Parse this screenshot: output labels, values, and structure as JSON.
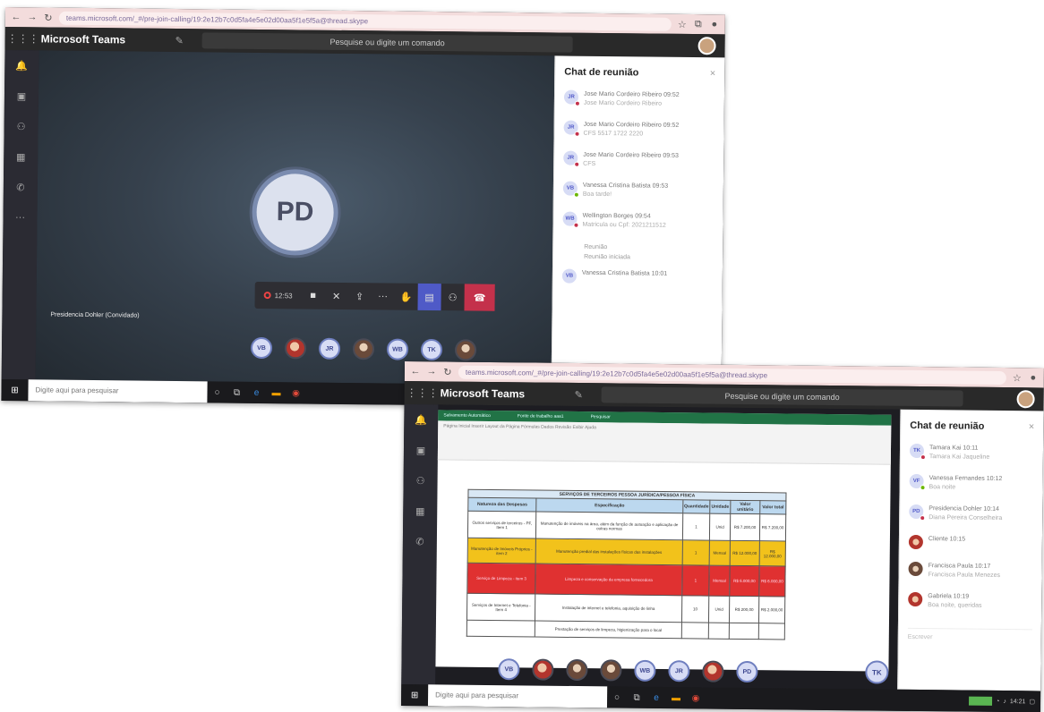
{
  "shot1": {
    "browser": {
      "url": "teams.microsoft.com/_#/pre-join-calling/19:2e12b7c0d5fa4e5e02d00aa5f1e5f5a@thread.skype"
    },
    "app_title": "Microsoft Teams",
    "search_placeholder": "Pesquise ou digite um comando",
    "presenter_initials": "PD",
    "presenter_name": "Presidencia Dohler (Convidado)",
    "call": {
      "timer": "12:53"
    },
    "participants": [
      "VB",
      "",
      "JR",
      "",
      "WB",
      "TK",
      ""
    ],
    "chat": {
      "title": "Chat de reunião",
      "messages": [
        {
          "initials": "JR",
          "line1": "Jose Mario Cordeiro Ribeiro 09:52",
          "line2": "Jose Mario Cordeiro Ribeiro"
        },
        {
          "initials": "JR",
          "line1": "Jose Mario Cordeiro Ribeiro 09:52",
          "line2": "CFS 5517 1722 2220"
        },
        {
          "initials": "JR",
          "line1": "Jose Mario Cordeiro Ribeiro 09:53",
          "line2": "CFS"
        },
        {
          "initials": "VB",
          "line1": "Vanessa Cristina Batista 09:53",
          "line2": "Boa tarde!"
        },
        {
          "initials": "WB",
          "line1": "Wellington Borges 09:54",
          "line2": "Matricula ou Cpf: 2021211512"
        }
      ],
      "notice": "Reunião",
      "notice_sub": "Reunião iniciada",
      "last_initials": "VB",
      "last_line": "Vanessa Cristina Batista 10:01"
    },
    "taskbar": {
      "search": "Digite aqui para pesquisar"
    }
  },
  "shot2": {
    "browser": {
      "url": "teams.microsoft.com/_#/pre-join-calling/19:2e12b7c0d5fa4e5e02d00aa5f1e5f5a@thread.skype"
    },
    "app_title": "Microsoft Teams",
    "search_placeholder": "Pesquise ou digite um comando",
    "excel": {
      "bar": [
        "Salvamento Automático",
        "Fonte de trabalho aaa1",
        "Pesquisar"
      ],
      "ribbon": "Página Inicial   Inserir   Layout da Página   Fórmulas   Dados   Revisão   Exibir   Ajuda",
      "caption": "SERVIÇOS DE TERCEIROS PESSOA JURÍDICA/PESSOA FÍSICA",
      "headers": [
        "Natureza das Despesas",
        "Especificação",
        "Quantidade",
        "Unidade",
        "Valor unitário",
        "Valor total"
      ],
      "rows": [
        [
          "Outros serviços de terceiros - PF, Item 1",
          "Manutenção de imóveis na área, além da função de autuação e aplicação de outras normas",
          "1",
          "Unid",
          "R$ 7.200,00",
          "R$ 7.200,00"
        ],
        [
          "Manutenção de Imóveis Próprios - item 2",
          "Manutenção predial das instalações físicas das instalações",
          "1",
          "Mensal",
          "R$ 12.000,00",
          "R$ 12.000,00"
        ],
        [
          "Serviço de Limpeza - item 3",
          "Limpeza e conservação da empresa fornecedora",
          "1",
          "Mensal",
          "R$ 6.000,00",
          "R$ 6.000,00"
        ],
        [
          "Serviços de Internet e Telefonia - Item 4",
          "Instalação de internet e telefonia, aquisição de linha",
          "10",
          "Unid",
          "R$ 200,00",
          "R$ 2.000,00"
        ],
        [
          "",
          "Prestação de serviços de limpeza, higienização para o local",
          "",
          "",
          "",
          ""
        ]
      ]
    },
    "participants": [
      "VB",
      "",
      "",
      "",
      "WB",
      "JR",
      "",
      "PD",
      "TK"
    ],
    "chat": {
      "title": "Chat de reunião",
      "messages": [
        {
          "initials": "TK",
          "line1": "Tamara Kai 10:11",
          "line2": "Tamara Kai Jaqueline"
        },
        {
          "initials": "VF",
          "line1": "Vanessa Fernandes 10:12",
          "line2": "Boa noite"
        },
        {
          "initials": "PD",
          "line1": "Presidencia Dohler 10:14",
          "line2": "Diana Pereira Conselheira"
        },
        {
          "initials": "",
          "line1": "Cliente 10:15",
          "line2": ""
        },
        {
          "initials": "",
          "line1": "Francisca Paula 10:17",
          "line2": "Francisca Paula Menezes"
        },
        {
          "initials": "",
          "line1": "Gabriela 10:19",
          "line2": "Boa noite, queridas"
        }
      ],
      "compose": "Escrever"
    },
    "taskbar": {
      "search": "Digite aqui para pesquisar",
      "time": "14:21"
    }
  },
  "colors": {
    "teams_dark": "#292929",
    "accent": "#4f5ac7",
    "hangup": "#c4314b",
    "excel_green": "#217346",
    "row_yellow": "#f2c21b",
    "row_red": "#e03131"
  }
}
